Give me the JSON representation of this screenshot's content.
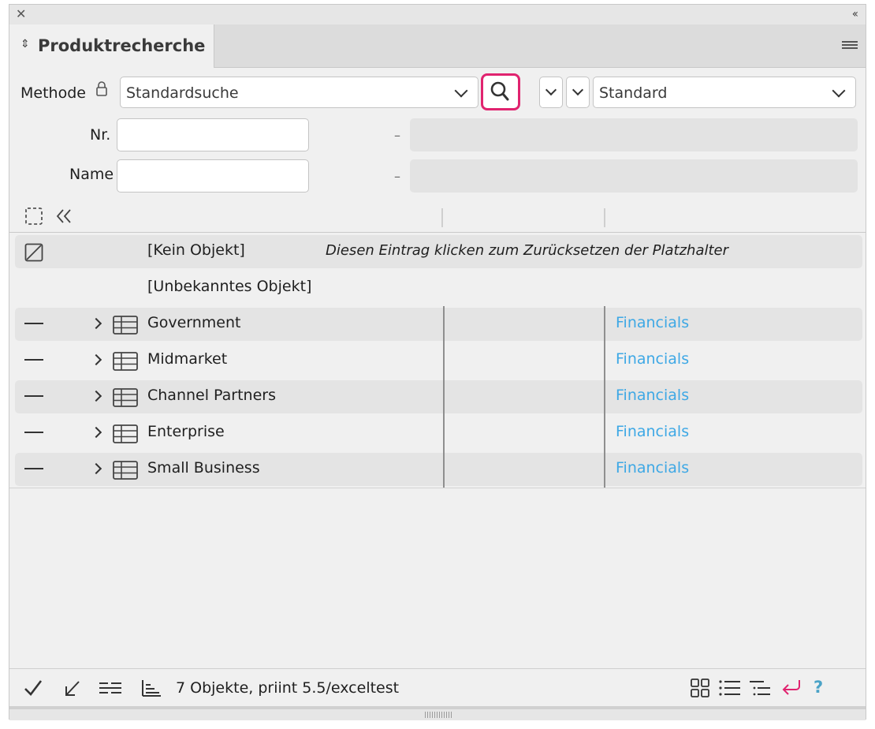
{
  "panel": {
    "tab_title": "Produktrecherche"
  },
  "search": {
    "method_label": "Methode",
    "method_value": "Standardsuche",
    "order_value": "Standard",
    "nr_label": "Nr.",
    "nr_value": "",
    "name_label": "Name",
    "name_value": "",
    "range_separator": "–"
  },
  "list": {
    "special_rows": [
      {
        "label": "[Kein Objekt]",
        "hint": "Diesen Eintrag klicken zum Zurücksetzen der Platzhalter"
      },
      {
        "label": "[Unbekanntes Objekt]"
      }
    ],
    "rows": [
      {
        "name": "Government",
        "link": "Financials"
      },
      {
        "name": "Midmarket",
        "link": "Financials"
      },
      {
        "name": "Channel Partners",
        "link": "Financials"
      },
      {
        "name": "Enterprise",
        "link": "Financials"
      },
      {
        "name": "Small Business",
        "link": "Financials"
      }
    ]
  },
  "status": {
    "text": "7 Objekte, priint 5.5/exceltest",
    "help_label": "?"
  },
  "colors": {
    "accent": "#e0236f",
    "link": "#3ea8e5",
    "help": "#4ba3c7"
  }
}
